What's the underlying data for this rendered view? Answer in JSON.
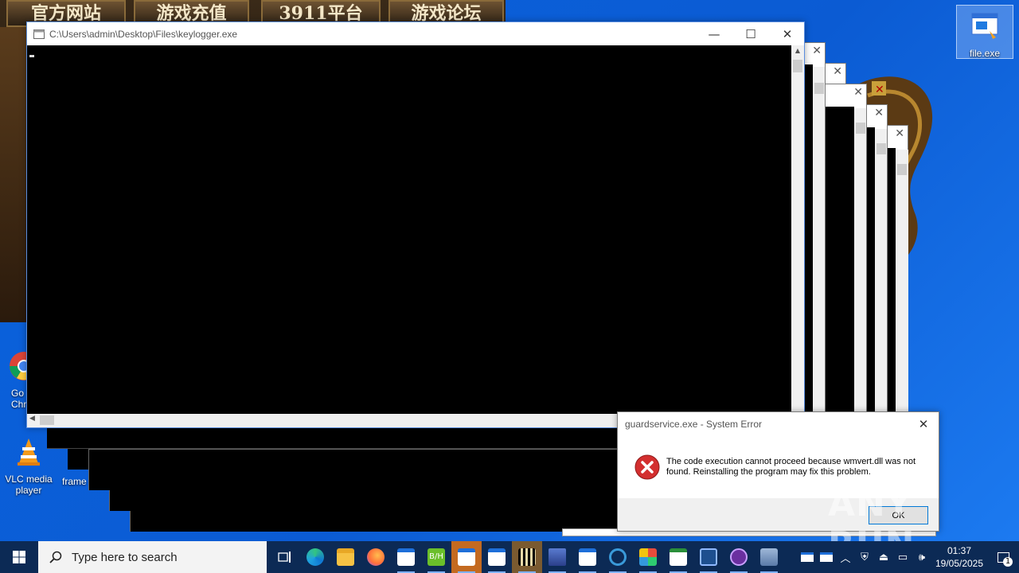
{
  "banner": {
    "buttons": [
      "官方网站",
      "游戏充值",
      "3911平台",
      "游戏论坛"
    ]
  },
  "desktop_icons": {
    "file_exe": "file.exe",
    "chrome_partial": "Go\nChr",
    "vlc": "VLC media player",
    "frame": "frame"
  },
  "console": {
    "title": "C:\\Users\\admin\\Desktop\\Files\\keylogger.exe",
    "minimize": "—",
    "maximize": "☐",
    "close": "✕"
  },
  "error_dialog": {
    "title": "guardservice.exe - System Error",
    "message": "The code execution cannot proceed because wmvert.dll was not found. Reinstalling the program may fix this problem.",
    "ok_label": "OK",
    "close": "✕"
  },
  "watermark": "ANY RUN",
  "taskbar": {
    "search_placeholder": "Type here to search",
    "time": "01:37",
    "date": "19/05/2025",
    "notification_count": "1",
    "pinned_icons": [
      "task-view-icon",
      "edge-icon",
      "file-explorer-icon",
      "firefox-icon",
      "window-app-icon",
      "bh-app-icon",
      "window-app-icon",
      "window-app-icon",
      "game-app-icon",
      "network-app-icon",
      "window-app-icon",
      "link-app-icon",
      "office-app-icon",
      "window-app-icon",
      "monitor-app-icon",
      "purple-app-icon",
      "installer-app-icon"
    ]
  },
  "colors": {
    "desktop": "#0b5bd3",
    "taskbar": "#0c2a55",
    "error_red": "#d32f2f"
  }
}
